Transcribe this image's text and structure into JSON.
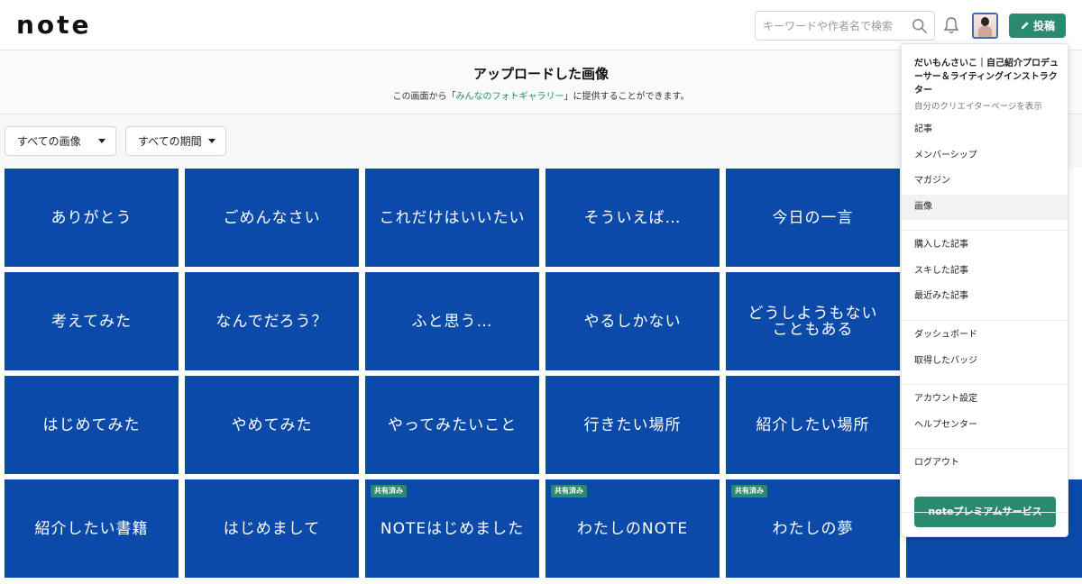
{
  "header": {
    "logo": "note",
    "search_placeholder": "キーワードや作者名で検索",
    "post_label": "投稿"
  },
  "page": {
    "title": "アップロードした画像",
    "sub_prefix": "この画面から「",
    "sub_link": "みんなのフォトギャラリー",
    "sub_suffix": "」に提供することができます。"
  },
  "filters": {
    "type": "すべての画像",
    "period": "すべての期間"
  },
  "tiles": [
    {
      "text": "ありがとう",
      "badge": ""
    },
    {
      "text": "ごめんなさい",
      "badge": ""
    },
    {
      "text": "これだけはいいたい",
      "badge": ""
    },
    {
      "text": "そういえば…",
      "badge": ""
    },
    {
      "text": "今日の一言",
      "badge": ""
    },
    {
      "text": "考えてみた",
      "badge": ""
    },
    {
      "text": "なんでだろう？",
      "badge": ""
    },
    {
      "text": "ふと思う…",
      "badge": ""
    },
    {
      "text": "やるしかない",
      "badge": ""
    },
    {
      "text": "どうしようもない\nこともある",
      "badge": ""
    },
    {
      "text": "はじめてみた",
      "badge": ""
    },
    {
      "text": "やめてみた",
      "badge": ""
    },
    {
      "text": "やってみたいこと",
      "badge": ""
    },
    {
      "text": "行きたい場所",
      "badge": ""
    },
    {
      "text": "紹介したい場所",
      "badge": ""
    },
    {
      "text": "紹介したい書籍",
      "badge": ""
    },
    {
      "text": "はじめまして",
      "badge": ""
    },
    {
      "text": "NOTEはじめました",
      "badge": "共有済み"
    },
    {
      "text": "わたしのNOTE",
      "badge": "共有済み"
    },
    {
      "text": "わたしの夢",
      "badge": "共有済み"
    }
  ],
  "menu": {
    "user_name": "だいもんさいこ｜自己紹介プロデューサー＆ライティングインストラクター",
    "creator_link": "自分のクリエイターページを表示",
    "groups": [
      [
        "記事",
        "メンバーシップ",
        "マガジン",
        "画像"
      ],
      [
        "購入した記事",
        "スキした記事",
        "最近みた記事"
      ],
      [
        "ダッシュボード",
        "取得したバッジ"
      ],
      [
        "アカウント設定",
        "ヘルプセンター"
      ],
      [
        "ログアウト"
      ]
    ],
    "active_item": "画像",
    "premium_label": "noteプレミアムサービス"
  },
  "colors": {
    "brand_green": "#2a8a70",
    "tile_blue": "#0b4aa8"
  }
}
